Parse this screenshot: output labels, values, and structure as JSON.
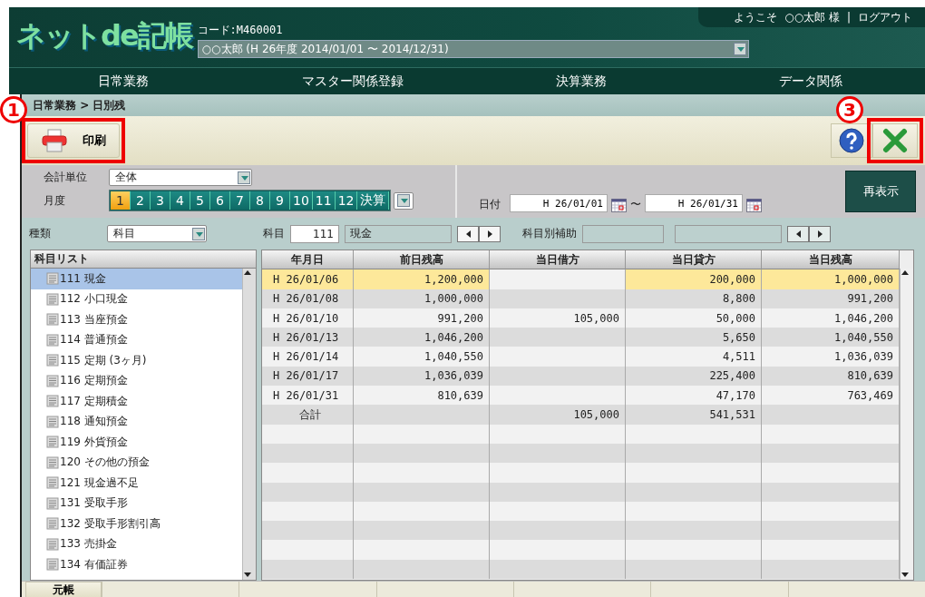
{
  "header": {
    "logo": "ネットde記帳",
    "code": "コード:M460001",
    "period": "○○太郎 (H 26年度 2014/01/01 〜 2014/12/31)",
    "welcome": "ようこそ",
    "user": "○○太郎 様",
    "separator": "|",
    "logout": "ログアウト"
  },
  "menu": [
    {
      "label": "日常業務"
    },
    {
      "label": "マスター関係登録"
    },
    {
      "label": "決算業務"
    },
    {
      "label": "データ関係"
    }
  ],
  "breadcrumb": "日常業務 > 日別残",
  "toolbar": {
    "print": {
      "label": "印刷",
      "callout": "1"
    },
    "close": {
      "callout": "3"
    }
  },
  "filters": {
    "unit_label": "会計単位",
    "unit_value": "全体",
    "month_label": "月度",
    "months": [
      {
        "label": "1",
        "selected": true
      },
      {
        "label": "2",
        "selected": false
      },
      {
        "label": "3",
        "selected": false
      },
      {
        "label": "4",
        "selected": false
      },
      {
        "label": "5",
        "selected": false
      },
      {
        "label": "6",
        "selected": false
      },
      {
        "label": "7",
        "selected": false
      },
      {
        "label": "8",
        "selected": false
      },
      {
        "label": "9",
        "selected": false
      },
      {
        "label": "10",
        "selected": false
      },
      {
        "label": "11",
        "selected": false
      },
      {
        "label": "12",
        "selected": false
      },
      {
        "label": "決算",
        "selected": false
      }
    ],
    "date_label": "日付",
    "date_from": "H 26/01/01",
    "tilde": "〜",
    "date_to": "H 26/01/31",
    "refresh": "再表示"
  },
  "subject_bar": {
    "kind_label": "種類",
    "kind_value": "科目",
    "subject_label": "科目",
    "subject_code": "111",
    "subject_name": "現金",
    "sub_label": "科目別補助"
  },
  "account_list": {
    "title": "科目リスト",
    "items": [
      {
        "label": "111 現金",
        "selected": true
      },
      {
        "label": "112 小口現金",
        "selected": false
      },
      {
        "label": "113 当座預金",
        "selected": false
      },
      {
        "label": "114 普通預金",
        "selected": false
      },
      {
        "label": "115 定期 (3ヶ月)",
        "selected": false
      },
      {
        "label": "116 定期預金",
        "selected": false
      },
      {
        "label": "117 定期積金",
        "selected": false
      },
      {
        "label": "118 通知預金",
        "selected": false
      },
      {
        "label": "119 外貨預金",
        "selected": false
      },
      {
        "label": "120 その他の預金",
        "selected": false
      },
      {
        "label": "121 現金過不足",
        "selected": false
      },
      {
        "label": "131 受取手形",
        "selected": false
      },
      {
        "label": "132 受取手形割引高",
        "selected": false
      },
      {
        "label": "133 売掛金",
        "selected": false
      },
      {
        "label": "134 有価証券",
        "selected": false
      }
    ]
  },
  "table": {
    "columns": [
      "年月日",
      "前日残高",
      "当日借方",
      "当日貸方",
      "当日残高"
    ],
    "rows": [
      {
        "kind": "entry",
        "selected": true,
        "cells": [
          "H 26/01/06",
          "1,200,000",
          null,
          "200,000",
          "1,000,000"
        ]
      },
      {
        "kind": "entry",
        "selected": false,
        "cells": [
          "H 26/01/08",
          "1,000,000",
          null,
          "8,800",
          "991,200"
        ]
      },
      {
        "kind": "entry",
        "selected": false,
        "cells": [
          "H 26/01/10",
          "991,200",
          "105,000",
          "50,000",
          "1,046,200"
        ]
      },
      {
        "kind": "entry",
        "selected": false,
        "cells": [
          "H 26/01/13",
          "1,046,200",
          null,
          "5,650",
          "1,040,550"
        ]
      },
      {
        "kind": "entry",
        "selected": false,
        "cells": [
          "H 26/01/14",
          "1,040,550",
          null,
          "4,511",
          "1,036,039"
        ]
      },
      {
        "kind": "entry",
        "selected": false,
        "cells": [
          "H 26/01/17",
          "1,036,039",
          null,
          "225,400",
          "810,639"
        ]
      },
      {
        "kind": "entry",
        "selected": false,
        "cells": [
          "H 26/01/31",
          "810,639",
          null,
          "47,170",
          "763,469"
        ]
      },
      {
        "kind": "total",
        "selected": false,
        "cells": [
          "合計",
          null,
          "105,000",
          "541,531",
          null
        ]
      }
    ]
  },
  "bottom_tabs": [
    {
      "label": "元帳"
    }
  ]
}
